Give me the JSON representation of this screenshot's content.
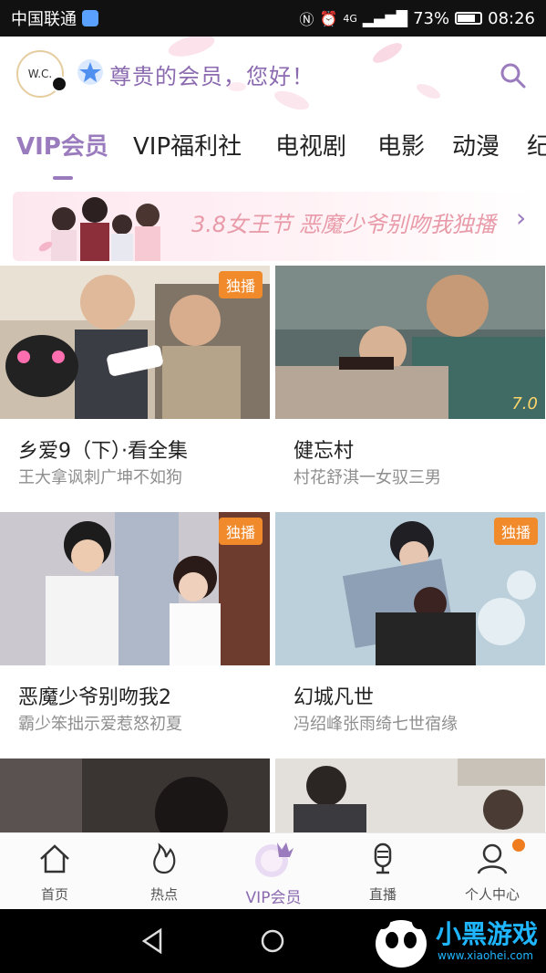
{
  "status_bar": {
    "carrier": "中国联通",
    "network": "4G",
    "battery": "73%",
    "time": "08:26"
  },
  "header": {
    "avatar_text": "W.C.",
    "greeting": "尊贵的会员，您好！"
  },
  "tabs": [
    {
      "label": "VIP会员",
      "active": true
    },
    {
      "label": "VIP福利社",
      "active": false
    },
    {
      "label": "电视剧",
      "active": false
    },
    {
      "label": "电影",
      "active": false
    },
    {
      "label": "动漫",
      "active": false
    },
    {
      "label": "纪",
      "active": false
    }
  ],
  "banner": {
    "text": "3.8女王节  恶魔少爷别吻我独播"
  },
  "cards": [
    {
      "title": "乡爱9（下）·看全集",
      "subtitle": "王大拿讽刺广坤不如狗",
      "badge": "独播",
      "rating": ""
    },
    {
      "title": "健忘村",
      "subtitle": "村花舒淇一女驭三男",
      "badge": "",
      "rating": "7.0"
    },
    {
      "title": "恶魔少爷别吻我2",
      "subtitle": "霸少笨拙示爱惹怒初夏",
      "badge": "独播",
      "rating": ""
    },
    {
      "title": "幻城凡世",
      "subtitle": "冯绍峰张雨绮七世宿缘",
      "badge": "独播",
      "rating": ""
    }
  ],
  "bottom_nav": [
    {
      "label": "首页",
      "icon": "home-icon",
      "active": false
    },
    {
      "label": "热点",
      "icon": "flame-icon",
      "active": false
    },
    {
      "label": "VIP会员",
      "icon": "vip-crown-icon",
      "active": true
    },
    {
      "label": "直播",
      "icon": "microphone-icon",
      "active": false
    },
    {
      "label": "个人中心",
      "icon": "person-icon",
      "active": false,
      "notification": true
    }
  ],
  "watermark": {
    "title": "小黑游戏",
    "url": "www.xiaohei.com"
  },
  "colors": {
    "accent": "#9a7bbd",
    "badge": "#f08a2b",
    "banner_text": "#e89aa8"
  }
}
